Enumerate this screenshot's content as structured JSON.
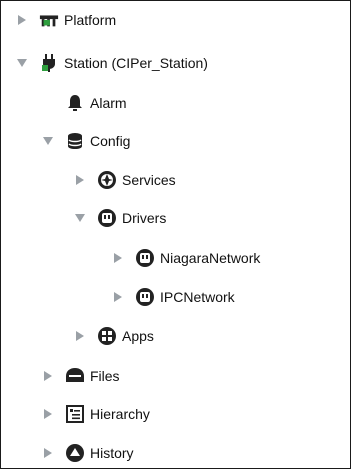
{
  "tree": {
    "platform": {
      "label": "Platform",
      "icon": "platform-icon",
      "expanded": false
    },
    "station": {
      "label": "Station (CIPer_Station)",
      "icon": "station-plug-icon",
      "expanded": true
    },
    "alarm": {
      "label": "Alarm",
      "icon": "bell-icon"
    },
    "config": {
      "label": "Config",
      "icon": "database-icon",
      "expanded": true
    },
    "services": {
      "label": "Services",
      "icon": "services-icon",
      "expanded": false
    },
    "drivers": {
      "label": "Drivers",
      "icon": "driver-icon",
      "expanded": true
    },
    "niagara_network": {
      "label": "NiagaraNetwork",
      "icon": "driver-icon",
      "expanded": false
    },
    "ipc_network": {
      "label": "IPCNetwork",
      "icon": "driver-icon",
      "expanded": false
    },
    "apps": {
      "label": "Apps",
      "icon": "apps-icon",
      "expanded": false
    },
    "files": {
      "label": "Files",
      "icon": "files-icon",
      "expanded": false
    },
    "hierarchy": {
      "label": "Hierarchy",
      "icon": "hierarchy-icon",
      "expanded": false
    },
    "history": {
      "label": "History",
      "icon": "history-icon",
      "expanded": false
    }
  },
  "colors": {
    "arrow": "#9aa0a6",
    "icon": "#222222",
    "accent_green": "#2e9e3e"
  }
}
